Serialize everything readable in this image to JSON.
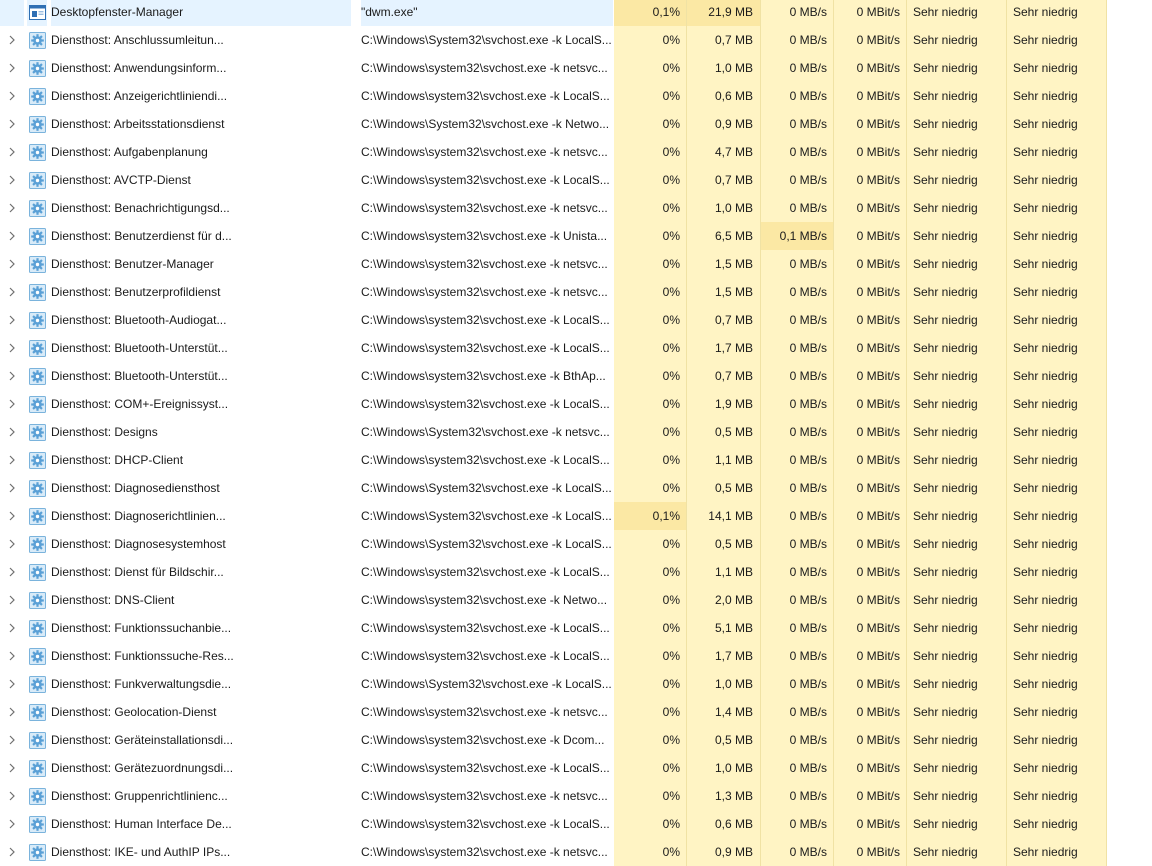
{
  "colors": {
    "heat_low": "#fff4c4",
    "heat_high": "#fbe8a4",
    "gear_fill": "#5aa0d6"
  },
  "icons": {
    "app": "application-window-icon",
    "service": "gear-service-icon",
    "expand": "chevron-right-icon"
  },
  "rows": [
    {
      "name": "Desktopfenster-Manager",
      "cmd": "\"dwm.exe\"",
      "cpu": "0,1%",
      "mem": "21,9 MB",
      "disk": "0 MB/s",
      "net": "0 MBit/s",
      "energy": "Sehr niedrig",
      "energy_trend": "Sehr niedrig",
      "expandable": false,
      "icon": "app",
      "hot": [
        "cpu",
        "mem"
      ]
    },
    {
      "name": "Diensthost: Anschlussumleitun...",
      "cmd": "C:\\Windows\\System32\\svchost.exe -k LocalS...",
      "cpu": "0%",
      "mem": "0,7 MB",
      "disk": "0 MB/s",
      "net": "0 MBit/s",
      "energy": "Sehr niedrig",
      "energy_trend": "Sehr niedrig",
      "expandable": true,
      "icon": "service",
      "hot": []
    },
    {
      "name": "Diensthost: Anwendungsinform...",
      "cmd": "C:\\Windows\\system32\\svchost.exe -k netsvc...",
      "cpu": "0%",
      "mem": "1,0 MB",
      "disk": "0 MB/s",
      "net": "0 MBit/s",
      "energy": "Sehr niedrig",
      "energy_trend": "Sehr niedrig",
      "expandable": true,
      "icon": "service",
      "hot": []
    },
    {
      "name": "Diensthost: Anzeigerichtliniendi...",
      "cmd": "C:\\Windows\\system32\\svchost.exe -k LocalS...",
      "cpu": "0%",
      "mem": "0,6 MB",
      "disk": "0 MB/s",
      "net": "0 MBit/s",
      "energy": "Sehr niedrig",
      "energy_trend": "Sehr niedrig",
      "expandable": true,
      "icon": "service",
      "hot": []
    },
    {
      "name": "Diensthost: Arbeitsstationsdienst",
      "cmd": "C:\\Windows\\System32\\svchost.exe -k Netwo...",
      "cpu": "0%",
      "mem": "0,9 MB",
      "disk": "0 MB/s",
      "net": "0 MBit/s",
      "energy": "Sehr niedrig",
      "energy_trend": "Sehr niedrig",
      "expandable": true,
      "icon": "service",
      "hot": []
    },
    {
      "name": "Diensthost: Aufgabenplanung",
      "cmd": "C:\\Windows\\system32\\svchost.exe -k netsvc...",
      "cpu": "0%",
      "mem": "4,7 MB",
      "disk": "0 MB/s",
      "net": "0 MBit/s",
      "energy": "Sehr niedrig",
      "energy_trend": "Sehr niedrig",
      "expandable": true,
      "icon": "service",
      "hot": []
    },
    {
      "name": "Diensthost: AVCTP-Dienst",
      "cmd": "C:\\Windows\\system32\\svchost.exe -k LocalS...",
      "cpu": "0%",
      "mem": "0,7 MB",
      "disk": "0 MB/s",
      "net": "0 MBit/s",
      "energy": "Sehr niedrig",
      "energy_trend": "Sehr niedrig",
      "expandable": true,
      "icon": "service",
      "hot": []
    },
    {
      "name": "Diensthost: Benachrichtigungsd...",
      "cmd": "C:\\Windows\\system32\\svchost.exe -k netsvc...",
      "cpu": "0%",
      "mem": "1,0 MB",
      "disk": "0 MB/s",
      "net": "0 MBit/s",
      "energy": "Sehr niedrig",
      "energy_trend": "Sehr niedrig",
      "expandable": true,
      "icon": "service",
      "hot": []
    },
    {
      "name": "Diensthost: Benutzerdienst für d...",
      "cmd": "C:\\Windows\\system32\\svchost.exe -k Unista...",
      "cpu": "0%",
      "mem": "6,5 MB",
      "disk": "0,1 MB/s",
      "net": "0 MBit/s",
      "energy": "Sehr niedrig",
      "energy_trend": "Sehr niedrig",
      "expandable": true,
      "icon": "service",
      "hot": [
        "disk"
      ]
    },
    {
      "name": "Diensthost: Benutzer-Manager",
      "cmd": "C:\\Windows\\system32\\svchost.exe -k netsvc...",
      "cpu": "0%",
      "mem": "1,5 MB",
      "disk": "0 MB/s",
      "net": "0 MBit/s",
      "energy": "Sehr niedrig",
      "energy_trend": "Sehr niedrig",
      "expandable": true,
      "icon": "service",
      "hot": []
    },
    {
      "name": "Diensthost: Benutzerprofildienst",
      "cmd": "C:\\Windows\\system32\\svchost.exe -k netsvc...",
      "cpu": "0%",
      "mem": "1,5 MB",
      "disk": "0 MB/s",
      "net": "0 MBit/s",
      "energy": "Sehr niedrig",
      "energy_trend": "Sehr niedrig",
      "expandable": true,
      "icon": "service",
      "hot": []
    },
    {
      "name": "Diensthost: Bluetooth-Audiogat...",
      "cmd": "C:\\Windows\\system32\\svchost.exe -k LocalS...",
      "cpu": "0%",
      "mem": "0,7 MB",
      "disk": "0 MB/s",
      "net": "0 MBit/s",
      "energy": "Sehr niedrig",
      "energy_trend": "Sehr niedrig",
      "expandable": true,
      "icon": "service",
      "hot": []
    },
    {
      "name": "Diensthost: Bluetooth-Unterstüt...",
      "cmd": "C:\\Windows\\system32\\svchost.exe -k LocalS...",
      "cpu": "0%",
      "mem": "1,7 MB",
      "disk": "0 MB/s",
      "net": "0 MBit/s",
      "energy": "Sehr niedrig",
      "energy_trend": "Sehr niedrig",
      "expandable": true,
      "icon": "service",
      "hot": []
    },
    {
      "name": "Diensthost: Bluetooth-Unterstüt...",
      "cmd": "C:\\Windows\\system32\\svchost.exe -k BthAp...",
      "cpu": "0%",
      "mem": "0,7 MB",
      "disk": "0 MB/s",
      "net": "0 MBit/s",
      "energy": "Sehr niedrig",
      "energy_trend": "Sehr niedrig",
      "expandable": true,
      "icon": "service",
      "hot": []
    },
    {
      "name": "Diensthost: COM+-Ereignissyst...",
      "cmd": "C:\\Windows\\system32\\svchost.exe -k LocalS...",
      "cpu": "0%",
      "mem": "1,9 MB",
      "disk": "0 MB/s",
      "net": "0 MBit/s",
      "energy": "Sehr niedrig",
      "energy_trend": "Sehr niedrig",
      "expandable": true,
      "icon": "service",
      "hot": []
    },
    {
      "name": "Diensthost: Designs",
      "cmd": "C:\\Windows\\System32\\svchost.exe -k netsvc...",
      "cpu": "0%",
      "mem": "0,5 MB",
      "disk": "0 MB/s",
      "net": "0 MBit/s",
      "energy": "Sehr niedrig",
      "energy_trend": "Sehr niedrig",
      "expandable": true,
      "icon": "service",
      "hot": []
    },
    {
      "name": "Diensthost: DHCP-Client",
      "cmd": "C:\\Windows\\system32\\svchost.exe -k LocalS...",
      "cpu": "0%",
      "mem": "1,1 MB",
      "disk": "0 MB/s",
      "net": "0 MBit/s",
      "energy": "Sehr niedrig",
      "energy_trend": "Sehr niedrig",
      "expandable": true,
      "icon": "service",
      "hot": []
    },
    {
      "name": "Diensthost: Diagnosediensthost",
      "cmd": "C:\\Windows\\System32\\svchost.exe -k LocalS...",
      "cpu": "0%",
      "mem": "0,5 MB",
      "disk": "0 MB/s",
      "net": "0 MBit/s",
      "energy": "Sehr niedrig",
      "energy_trend": "Sehr niedrig",
      "expandable": true,
      "icon": "service",
      "hot": []
    },
    {
      "name": "Diensthost: Diagnoserichtlinien...",
      "cmd": "C:\\Windows\\System32\\svchost.exe -k LocalS...",
      "cpu": "0,1%",
      "mem": "14,1 MB",
      "disk": "0 MB/s",
      "net": "0 MBit/s",
      "energy": "Sehr niedrig",
      "energy_trend": "Sehr niedrig",
      "expandable": true,
      "icon": "service",
      "hot": [
        "cpu"
      ]
    },
    {
      "name": "Diensthost: Diagnosesystemhost",
      "cmd": "C:\\Windows\\System32\\svchost.exe -k LocalS...",
      "cpu": "0%",
      "mem": "0,5 MB",
      "disk": "0 MB/s",
      "net": "0 MBit/s",
      "energy": "Sehr niedrig",
      "energy_trend": "Sehr niedrig",
      "expandable": true,
      "icon": "service",
      "hot": []
    },
    {
      "name": "Diensthost: Dienst für Bildschir...",
      "cmd": "C:\\Windows\\system32\\svchost.exe -k LocalS...",
      "cpu": "0%",
      "mem": "1,1 MB",
      "disk": "0 MB/s",
      "net": "0 MBit/s",
      "energy": "Sehr niedrig",
      "energy_trend": "Sehr niedrig",
      "expandable": true,
      "icon": "service",
      "hot": []
    },
    {
      "name": "Diensthost: DNS-Client",
      "cmd": "C:\\Windows\\system32\\svchost.exe -k Netwo...",
      "cpu": "0%",
      "mem": "2,0 MB",
      "disk": "0 MB/s",
      "net": "0 MBit/s",
      "energy": "Sehr niedrig",
      "energy_trend": "Sehr niedrig",
      "expandable": true,
      "icon": "service",
      "hot": []
    },
    {
      "name": "Diensthost: Funktionssuchanbie...",
      "cmd": "C:\\Windows\\system32\\svchost.exe -k LocalS...",
      "cpu": "0%",
      "mem": "5,1 MB",
      "disk": "0 MB/s",
      "net": "0 MBit/s",
      "energy": "Sehr niedrig",
      "energy_trend": "Sehr niedrig",
      "expandable": true,
      "icon": "service",
      "hot": []
    },
    {
      "name": "Diensthost: Funktionssuche-Res...",
      "cmd": "C:\\Windows\\system32\\svchost.exe -k LocalS...",
      "cpu": "0%",
      "mem": "1,7 MB",
      "disk": "0 MB/s",
      "net": "0 MBit/s",
      "energy": "Sehr niedrig",
      "energy_trend": "Sehr niedrig",
      "expandable": true,
      "icon": "service",
      "hot": []
    },
    {
      "name": "Diensthost: Funkverwaltungsdie...",
      "cmd": "C:\\Windows\\System32\\svchost.exe -k LocalS...",
      "cpu": "0%",
      "mem": "1,0 MB",
      "disk": "0 MB/s",
      "net": "0 MBit/s",
      "energy": "Sehr niedrig",
      "energy_trend": "Sehr niedrig",
      "expandable": true,
      "icon": "service",
      "hot": []
    },
    {
      "name": "Diensthost: Geolocation-Dienst",
      "cmd": "C:\\Windows\\system32\\svchost.exe -k netsvc...",
      "cpu": "0%",
      "mem": "1,4 MB",
      "disk": "0 MB/s",
      "net": "0 MBit/s",
      "energy": "Sehr niedrig",
      "energy_trend": "Sehr niedrig",
      "expandable": true,
      "icon": "service",
      "hot": []
    },
    {
      "name": "Diensthost: Geräteinstallationsdi...",
      "cmd": "C:\\Windows\\system32\\svchost.exe -k Dcom...",
      "cpu": "0%",
      "mem": "0,5 MB",
      "disk": "0 MB/s",
      "net": "0 MBit/s",
      "energy": "Sehr niedrig",
      "energy_trend": "Sehr niedrig",
      "expandable": true,
      "icon": "service",
      "hot": []
    },
    {
      "name": "Diensthost: Gerätezuordnungsdi...",
      "cmd": "C:\\Windows\\system32\\svchost.exe -k LocalS...",
      "cpu": "0%",
      "mem": "1,0 MB",
      "disk": "0 MB/s",
      "net": "0 MBit/s",
      "energy": "Sehr niedrig",
      "energy_trend": "Sehr niedrig",
      "expandable": true,
      "icon": "service",
      "hot": []
    },
    {
      "name": "Diensthost: Gruppenrichtlinienc...",
      "cmd": "C:\\Windows\\system32\\svchost.exe -k netsvc...",
      "cpu": "0%",
      "mem": "1,3 MB",
      "disk": "0 MB/s",
      "net": "0 MBit/s",
      "energy": "Sehr niedrig",
      "energy_trend": "Sehr niedrig",
      "expandable": true,
      "icon": "service",
      "hot": []
    },
    {
      "name": "Diensthost: Human Interface De...",
      "cmd": "C:\\Windows\\system32\\svchost.exe -k LocalS...",
      "cpu": "0%",
      "mem": "0,6 MB",
      "disk": "0 MB/s",
      "net": "0 MBit/s",
      "energy": "Sehr niedrig",
      "energy_trend": "Sehr niedrig",
      "expandable": true,
      "icon": "service",
      "hot": []
    },
    {
      "name": "Diensthost: IKE- und AuthIP IPs...",
      "cmd": "C:\\Windows\\system32\\svchost.exe -k netsvc...",
      "cpu": "0%",
      "mem": "0,9 MB",
      "disk": "0 MB/s",
      "net": "0 MBit/s",
      "energy": "Sehr niedrig",
      "energy_trend": "Sehr niedrig",
      "expandable": true,
      "icon": "service",
      "hot": []
    }
  ]
}
